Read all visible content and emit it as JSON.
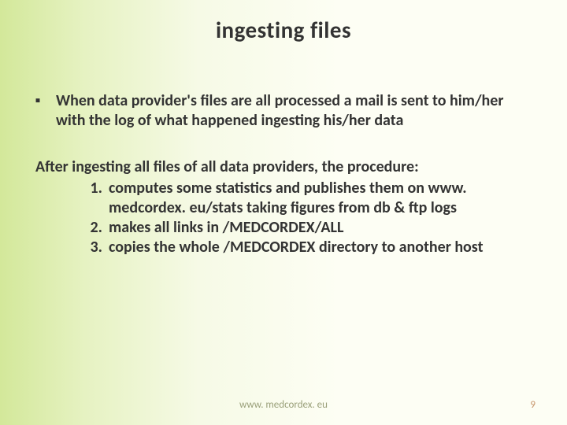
{
  "title": "ingesting files",
  "bullet_text": "When data provider's files are all processed a mail is sent to him/her with the log of what happened ingesting his/her data",
  "after_text": "After ingesting all files of all data providers, the procedure:",
  "items": {
    "0": {
      "num": "1.",
      "text": "computes some statistics and publishes them on www. medcordex. eu/stats taking figures from db & ftp logs"
    },
    "1": {
      "num": "2.",
      "text": "makes all links in /MEDCORDEX/ALL"
    },
    "2": {
      "num": "3.",
      "text": "copies the whole /MEDCORDEX directory to another host"
    }
  },
  "footer_url": "www. medcordex. eu",
  "page_number": "9"
}
